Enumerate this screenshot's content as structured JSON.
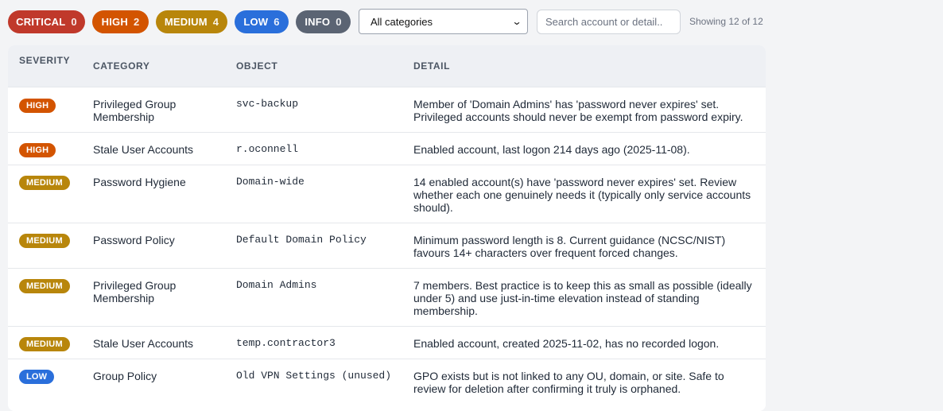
{
  "filters": {
    "pills": [
      {
        "label": "CRITICAL",
        "count": "0"
      },
      {
        "label": "HIGH",
        "count": "2"
      },
      {
        "label": "MEDIUM",
        "count": "4"
      },
      {
        "label": "LOW",
        "count": "6"
      },
      {
        "label": "INFO",
        "count": "0"
      }
    ],
    "category_select": "All categories",
    "search_placeholder": "Search account or detail..",
    "showing": "Showing 12 of 12"
  },
  "colors": {
    "critical": "#c0392b",
    "high": "#d35400",
    "medium": "#b8860b",
    "low": "#2a6fdb",
    "info": "#5b6473"
  },
  "table": {
    "headers": {
      "severity": "SEVERITY",
      "category": "CATEGORY",
      "object": "OBJECT",
      "detail": "DETAIL"
    },
    "rows": [
      {
        "severity": "HIGH",
        "category": "Privileged Group Membership",
        "object": "svc-backup",
        "detail": "Member of 'Domain Admins' has 'password never expires' set. Privileged accounts should never be exempt from password expiry."
      },
      {
        "severity": "HIGH",
        "category": "Stale User Accounts",
        "object": "r.oconnell",
        "detail": "Enabled account, last logon 214 days ago (2025-11-08)."
      },
      {
        "severity": "MEDIUM",
        "category": "Password Hygiene",
        "object": "Domain-wide",
        "detail": "14 enabled account(s) have 'password never expires' set. Review whether each one genuinely needs it (typically only service accounts should)."
      },
      {
        "severity": "MEDIUM",
        "category": "Password Policy",
        "object": "Default Domain Policy",
        "detail": "Minimum password length is 8. Current guidance (NCSC/NIST) favours 14+ characters over frequent forced changes."
      },
      {
        "severity": "MEDIUM",
        "category": "Privileged Group Membership",
        "object": "Domain Admins",
        "detail": "7 members. Best practice is to keep this as small as possible (ideally under 5) and use just-in-time elevation instead of standing membership."
      },
      {
        "severity": "MEDIUM",
        "category": "Stale User Accounts",
        "object": "temp.contractor3",
        "detail": "Enabled account, created 2025-11-02, has no recorded logon."
      },
      {
        "severity": "LOW",
        "category": "Group Policy",
        "object": "Old VPN Settings (unused)",
        "detail": "GPO exists but is not linked to any OU, domain, or site. Safe to review for deletion after confirming it truly is orphaned."
      }
    ]
  }
}
